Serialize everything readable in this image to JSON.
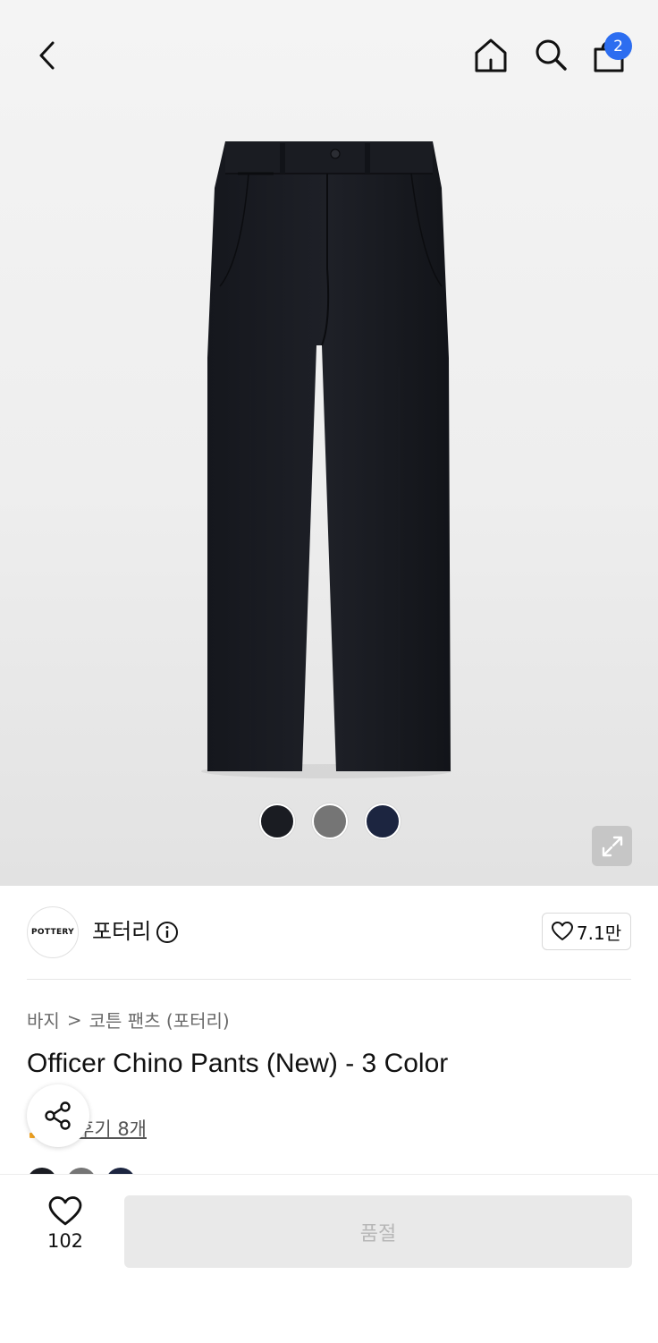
{
  "header": {
    "cart_count": "2",
    "icons": [
      "back-arrow-icon",
      "home-icon",
      "search-icon",
      "bag-icon"
    ]
  },
  "product_image": {
    "swatch_colors": [
      "#1a1c22",
      "#757575",
      "#1c2540"
    ],
    "icons": [
      "expand-icon"
    ]
  },
  "brand": {
    "logo_text": "POTTERY",
    "name": "포터리",
    "like_count": "7.1만"
  },
  "breadcrumb": {
    "items": [
      "바지",
      "코튼 팬츠 (포터리)"
    ],
    "separator": ">"
  },
  "product": {
    "title": "Officer Chino Pants (New) - 3 Color",
    "review_link": "후기 8개"
  },
  "bottom_bar": {
    "wish_count": "102",
    "buy_label": "품절"
  },
  "colors": {
    "accent": "#2c6df0",
    "soldout_bg": "#e9e9e9",
    "soldout_text": "#b7b7b7"
  }
}
